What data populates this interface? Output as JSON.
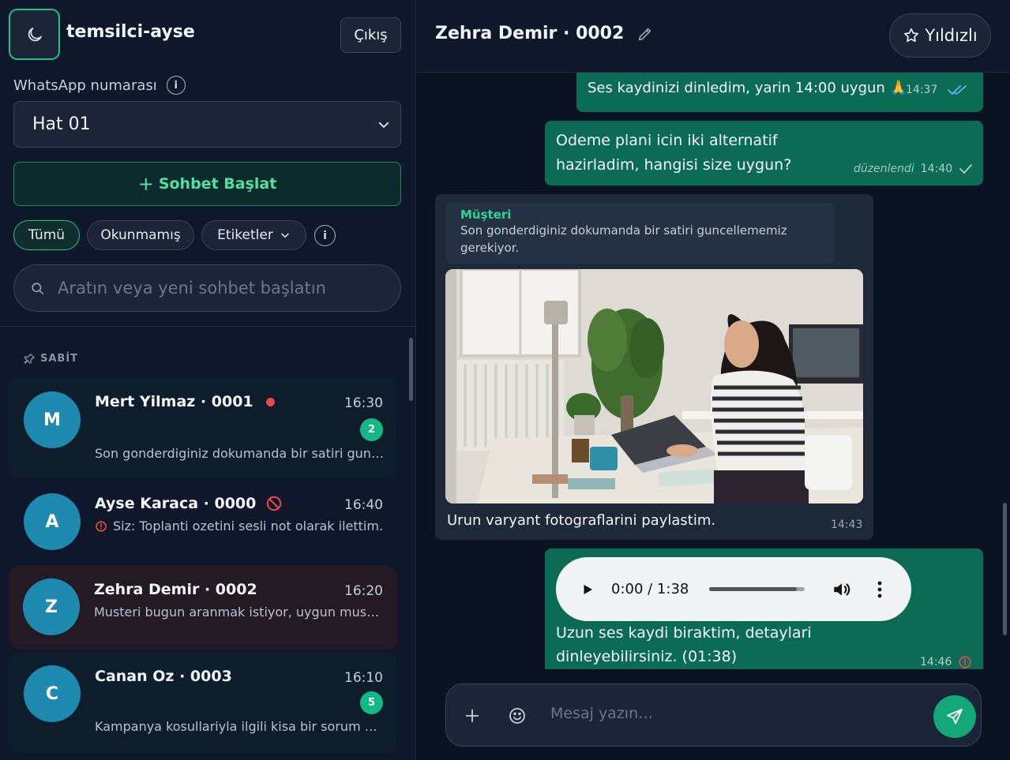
{
  "sidebar": {
    "user_name": "temsilci-ayse",
    "logout_label": "Çıkış",
    "whatsapp_label": "WhatsApp numarası",
    "selected_line": "Hat 01",
    "start_chat_label": "Sohbet Başlat",
    "filters": [
      "Tümü",
      "Okunmamış",
      "Etiketler"
    ],
    "search_placeholder": "Aratın veya yeni sohbet başlatın",
    "pinned_label": "SABİT",
    "chats": [
      {
        "initial": "M",
        "name": "Mert Yilmaz · 0001",
        "time": "16:30",
        "preview": "Son gonderdiginiz dokumanda bir satiri guncellememiz gerekiyor.",
        "unread": "2"
      },
      {
        "initial": "A",
        "name": "Ayse Karaca · 0000",
        "time": "16:40",
        "preview": "Siz: Toplanti ozetini sesli not olarak ilettim."
      },
      {
        "initial": "Z",
        "name": "Zehra Demir · 0002",
        "time": "16:20",
        "preview": "Musteri bugun aranmak istiyor, uygun musunuz?"
      },
      {
        "initial": "C",
        "name": "Canan Oz · 0003",
        "time": "16:10",
        "preview": "Kampanya kosullariyla ilgili kisa bir sorum olacak.",
        "unread": "5"
      }
    ]
  },
  "chat": {
    "title": "Zehra Demir · 0002",
    "starred_label": "Yıldızlı",
    "messages": [
      {
        "text": "Ses kaydinizi dinledim, yarin 14:00 uygun 🙏",
        "time": "14:37"
      },
      {
        "line1": "Odeme plani icin iki alternatif",
        "line2": "hazirladim, hangisi size uygun?",
        "edited": "düzenlendi",
        "time": "14:40"
      },
      {
        "quote_author": "Müşteri",
        "quote_line1": "Son gonderdiginiz dokumanda bir satiri guncellememiz",
        "quote_line2": "gerekiyor.",
        "caption": "Urun varyant fotograflarini paylastim.",
        "time": "14:43"
      },
      {
        "audio_time": "0:00 / 1:38",
        "line1": "Uzun ses kaydi biraktim, detaylari",
        "line2": "dinleyebilirsiniz. (01:38)",
        "time": "14:46"
      }
    ],
    "composer_placeholder": "Mesaj yazın…"
  },
  "colors": {
    "accent": "#13a877",
    "outgoing": "#0c6b55",
    "incoming": "#1d2838",
    "error": "#f04848"
  }
}
